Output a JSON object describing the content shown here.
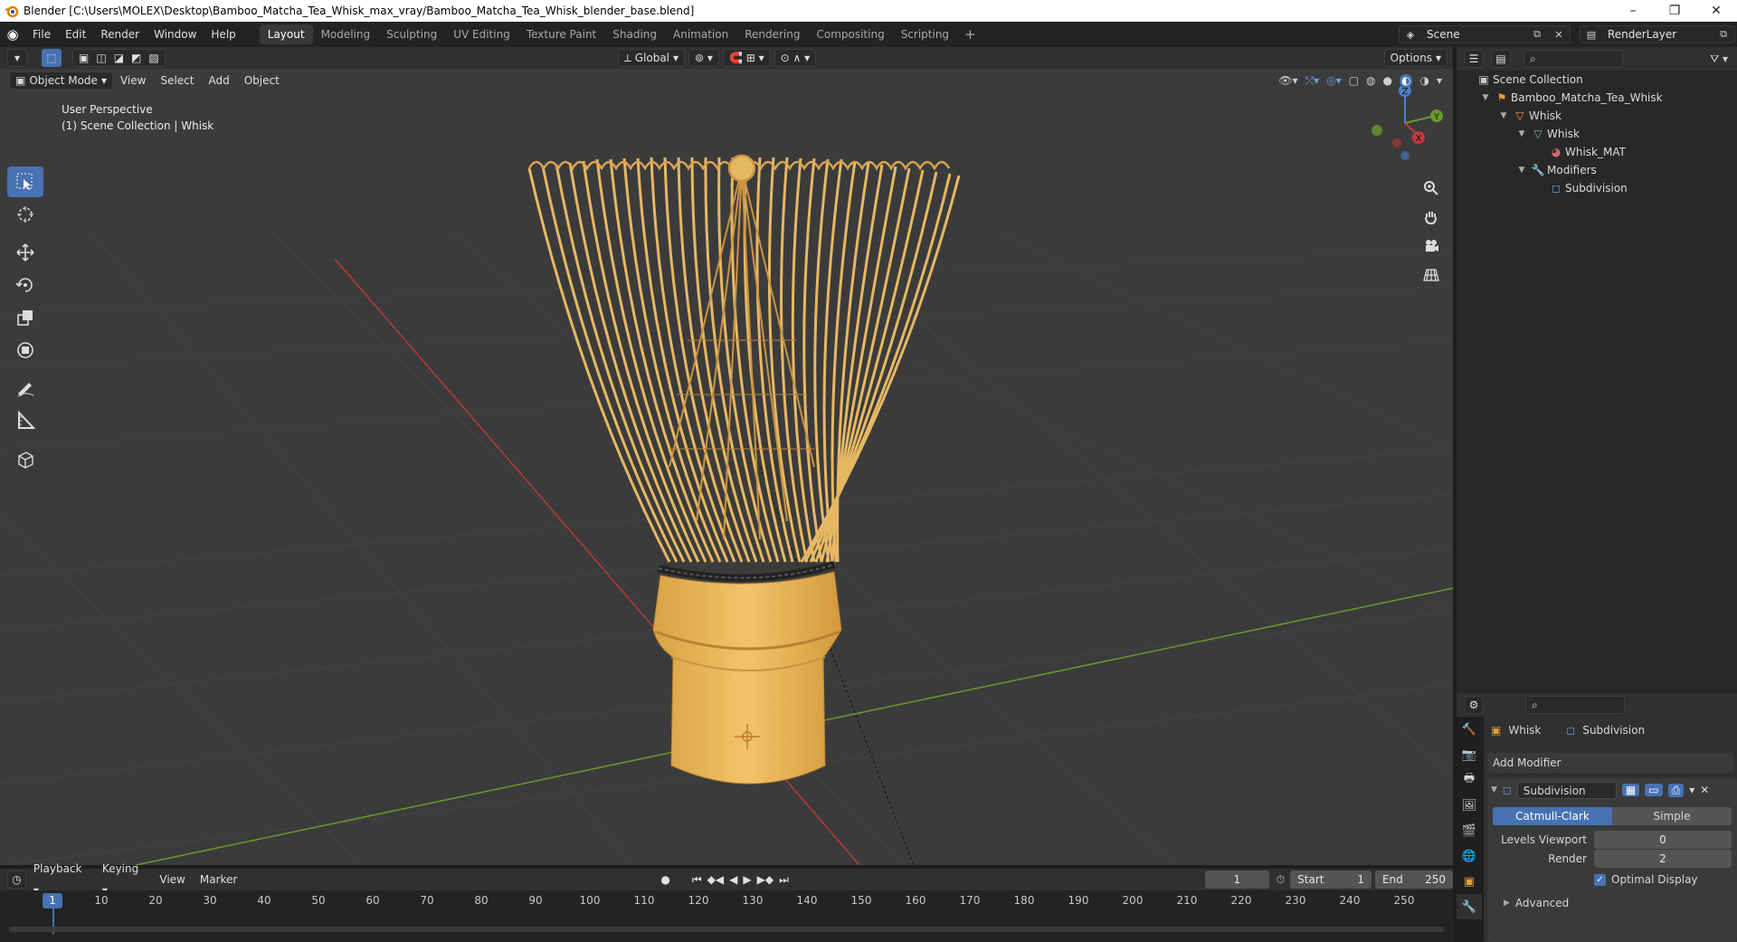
{
  "window": {
    "title": "Blender [C:\\Users\\MOLEX\\Desktop\\Bamboo_Matcha_Tea_Whisk_max_vray/Bamboo_Matcha_Tea_Whisk_blender_base.blend]",
    "minimize": "–",
    "maximize": "❐",
    "close": "✕"
  },
  "menu": {
    "file": "File",
    "edit": "Edit",
    "render": "Render",
    "window": "Window",
    "help": "Help"
  },
  "workspaces": [
    "Layout",
    "Modeling",
    "Sculpting",
    "UV Editing",
    "Texture Paint",
    "Shading",
    "Animation",
    "Rendering",
    "Compositing",
    "Scripting"
  ],
  "active_workspace": "Layout",
  "scene": {
    "name": "Scene",
    "render_layer": "RenderLayer"
  },
  "viewport": {
    "orientation": "Global",
    "options": "Options",
    "mode": "Object Mode",
    "view": "View",
    "select": "Select",
    "add": "Add",
    "object": "Object",
    "perspective": "User Perspective",
    "collection_info": "(1) Scene Collection | Whisk",
    "gizmo": {
      "z": "Z",
      "y": "Y",
      "x": "X"
    }
  },
  "timeline": {
    "playback": "Playback",
    "keying": "Keying",
    "view": "View",
    "marker": "Marker",
    "current_frame": "1",
    "start_label": "Start",
    "start": "1",
    "end_label": "End",
    "end": "250",
    "ticks": [
      "10",
      "20",
      "30",
      "40",
      "50",
      "60",
      "70",
      "80",
      "90",
      "100",
      "110",
      "120",
      "130",
      "140",
      "150",
      "160",
      "170",
      "180",
      "190",
      "200",
      "210",
      "220",
      "230",
      "240",
      "250"
    ]
  },
  "outliner": {
    "root": "Scene Collection",
    "collection": "Bamboo_Matcha_Tea_Whisk",
    "object": "Whisk",
    "mesh": "Whisk",
    "material": "Whisk_MAT",
    "modifiers": "Modifiers",
    "modifier": "Subdivision"
  },
  "properties": {
    "object": "Whisk",
    "modifier_crumb": "Subdivision",
    "add_modifier": "Add Modifier",
    "modifier_name": "Subdivision",
    "catmull": "Catmull-Clark",
    "simple": "Simple",
    "levels_viewport_label": "Levels Viewport",
    "levels_viewport": "0",
    "render_label": "Render",
    "render_levels": "2",
    "optimal_display": "Optimal Display",
    "advanced": "Advanced"
  },
  "colors": {
    "accent": "#4772b3",
    "x_axis": "#c0393b",
    "y_axis": "#6a9a2a",
    "bamboo": "#e6b864"
  }
}
